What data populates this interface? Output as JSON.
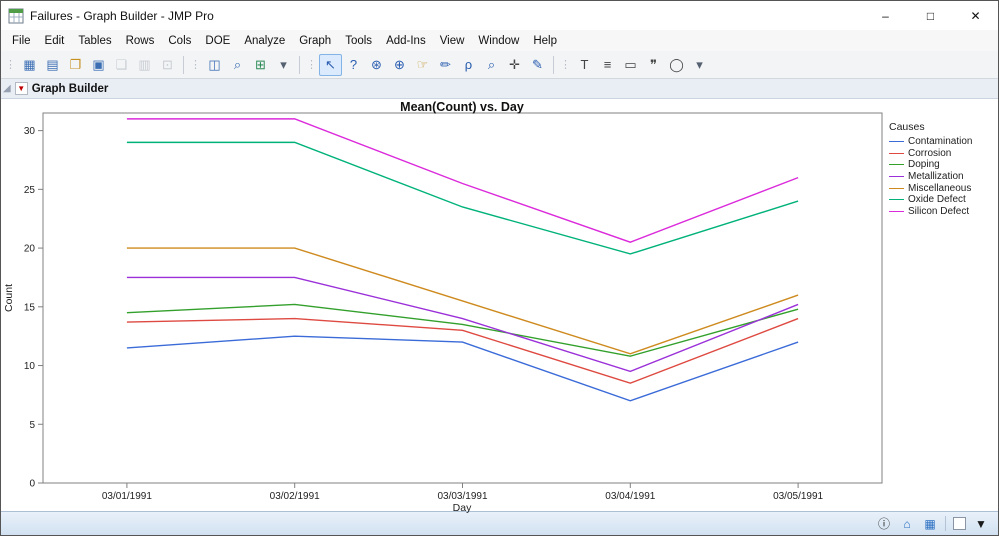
{
  "window": {
    "title": "Failures - Graph Builder - JMP Pro",
    "controls": {
      "minimize": "–",
      "maximize": "□",
      "close": "✕"
    }
  },
  "menubar": {
    "items": [
      "File",
      "Edit",
      "Tables",
      "Rows",
      "Cols",
      "DOE",
      "Analyze",
      "Graph",
      "Tools",
      "Add-Ins",
      "View",
      "Window",
      "Help"
    ]
  },
  "toolbar": {
    "groups": [
      {
        "icons": [
          {
            "name": "new-data-table-icon",
            "glyph": "▦",
            "color": "#3c6eb4"
          },
          {
            "name": "new-journal-icon",
            "glyph": "▤",
            "color": "#3c6eb4"
          },
          {
            "name": "open-icon",
            "glyph": "❐",
            "color": "#c79121"
          },
          {
            "name": "save-icon",
            "glyph": "▣",
            "color": "#3c6eb4"
          },
          {
            "name": "copy-icon",
            "glyph": "❏",
            "color": "#8d949c",
            "disabled": true
          },
          {
            "name": "paste-icon",
            "glyph": "▥",
            "color": "#8d949c",
            "disabled": true
          },
          {
            "name": "lock-icon",
            "glyph": "⊡",
            "color": "#8d949c",
            "disabled": true
          }
        ]
      },
      {
        "icons": [
          {
            "name": "data-table-window-icon",
            "glyph": "◫",
            "color": "#3c6eb4"
          },
          {
            "name": "search-icon",
            "glyph": "⌕",
            "color": "#3c6eb4"
          },
          {
            "name": "graph-builder-icon",
            "glyph": "⊞",
            "color": "#2e8b57"
          },
          {
            "name": "toolbar-overflow-icon",
            "glyph": "▾",
            "color": "#556070"
          }
        ]
      },
      {
        "icons": [
          {
            "name": "arrow-tool-icon",
            "glyph": "↖",
            "color": "#2a5db0",
            "selected": true
          },
          {
            "name": "help-tool-icon",
            "glyph": "?",
            "color": "#2a5db0"
          },
          {
            "name": "zoom-region-icon",
            "glyph": "⊛",
            "color": "#2a5db0"
          },
          {
            "name": "globe-tool-icon",
            "glyph": "⊕",
            "color": "#2a5db0"
          },
          {
            "name": "grabber-tool-icon",
            "glyph": "☞",
            "color": "#c79121"
          },
          {
            "name": "brush-tool-icon",
            "glyph": "✏",
            "color": "#2a5db0"
          },
          {
            "name": "lasso-tool-icon",
            "glyph": "ρ",
            "color": "#2a5db0"
          },
          {
            "name": "magnifier-tool-icon",
            "glyph": "⌕",
            "color": "#2a5db0"
          },
          {
            "name": "crosshair-tool-icon",
            "glyph": "✛",
            "color": "#444444"
          },
          {
            "name": "eraser-tool-icon",
            "glyph": "✎",
            "color": "#2a5db0"
          }
        ]
      },
      {
        "icons": [
          {
            "name": "text-annotation-icon",
            "glyph": "T",
            "color": "#444444"
          },
          {
            "name": "line-annotation-icon",
            "glyph": "≡",
            "color": "#444444"
          },
          {
            "name": "shape-annotation-icon",
            "glyph": "▭",
            "color": "#444444"
          },
          {
            "name": "callout-annotation-icon",
            "glyph": "❞",
            "color": "#444444"
          },
          {
            "name": "oval-annotation-icon",
            "glyph": "◯",
            "color": "#444444"
          },
          {
            "name": "toolbar-overflow-icon",
            "glyph": "▾",
            "color": "#556070"
          }
        ]
      }
    ]
  },
  "report": {
    "outline_title": "Graph Builder"
  },
  "chart_data": {
    "type": "line",
    "title": "Mean(Count) vs. Day",
    "xlabel": "Day",
    "ylabel": "Count",
    "legend_title": "Causes",
    "legend_position": "right",
    "grid": false,
    "ylim": [
      0,
      31.5
    ],
    "yticks": [
      0,
      5,
      10,
      15,
      20,
      25,
      30
    ],
    "categories": [
      "03/01/1991",
      "03/02/1991",
      "03/03/1991",
      "03/04/1991",
      "03/05/1991"
    ],
    "series": [
      {
        "name": "Contamination",
        "color": "#3b6bd8",
        "values": [
          11.5,
          12.5,
          12,
          7,
          12
        ]
      },
      {
        "name": "Corrosion",
        "color": "#de4a41",
        "values": [
          13.7,
          14,
          13,
          8.5,
          14
        ]
      },
      {
        "name": "Doping",
        "color": "#33a02c",
        "values": [
          14.5,
          15.2,
          13.5,
          10.8,
          14.8
        ]
      },
      {
        "name": "Metallization",
        "color": "#9b30d9",
        "values": [
          17.5,
          17.5,
          14,
          9.5,
          15.2
        ]
      },
      {
        "name": "Miscellaneous",
        "color": "#ce8a1e",
        "values": [
          20,
          20,
          15.5,
          11,
          16
        ]
      },
      {
        "name": "Oxide Defect",
        "color": "#00b27a",
        "values": [
          29,
          29,
          23.5,
          19.5,
          24
        ]
      },
      {
        "name": "Silicon Defect",
        "color": "#db2adb",
        "values": [
          31,
          31,
          25.5,
          20.5,
          26
        ]
      }
    ]
  },
  "statusbar": {
    "icons": [
      {
        "name": "info-icon",
        "glyph": "ⓘ",
        "color": "#1a1a1a"
      },
      {
        "name": "show-panel-icon",
        "glyph": "⌂",
        "color": "#2a6fc2"
      },
      {
        "name": "data-view-icon",
        "glyph": "▦",
        "color": "#2a6fc2"
      },
      {
        "name": "statusbar-separator",
        "sep": true
      },
      {
        "name": "annotation-color-box",
        "box": true
      },
      {
        "name": "statusbar-dropdown-icon",
        "glyph": "▼",
        "color": "#1a1a1a"
      }
    ]
  }
}
